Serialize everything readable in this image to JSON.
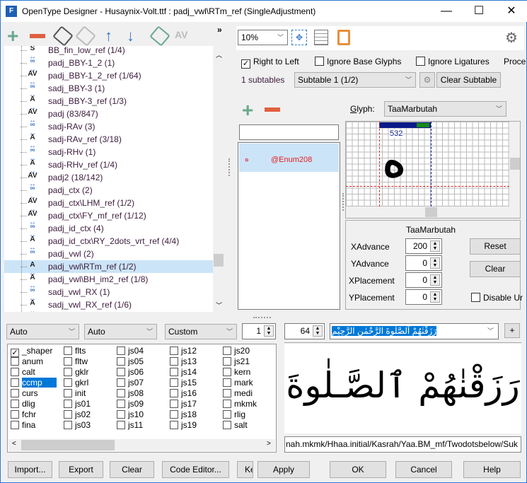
{
  "window": {
    "title": "OpenType Designer - Husaynix-Volt.ttf : padj_vwl\\RTm_ref (SingleAdjustment)",
    "app_icon": "F",
    "minimize": "—",
    "maximize": "☐",
    "close": "✕"
  },
  "left_toolbar": {
    "more": "»"
  },
  "tree": {
    "items": [
      {
        "label": "BB_fin_low_ref (1/4)",
        "icon": "S"
      },
      {
        "label": "padj_BBY-1_2 (1)",
        "icon": "link"
      },
      {
        "label": "padj_BBY-1_2_ref (1/64)",
        "icon": "AV"
      },
      {
        "label": "sadj_BBY-3 (1)",
        "icon": "link"
      },
      {
        "label": "sadj_BBY-3_ref (1/3)",
        "icon": "A"
      },
      {
        "label": "padj (83/847)",
        "icon": "AV"
      },
      {
        "label": "sadj-RAv (3)",
        "icon": "link"
      },
      {
        "label": "sadj-RAv_ref (3/18)",
        "icon": "A"
      },
      {
        "label": "sadj-RHv (1)",
        "icon": "link"
      },
      {
        "label": "sadj-RHv_ref (1/4)",
        "icon": "A"
      },
      {
        "label": "padj2 (18/142)",
        "icon": "AV"
      },
      {
        "label": "padj_ctx (2)",
        "icon": "link"
      },
      {
        "label": "padj_ctx\\LHM_ref (1/2)",
        "icon": "AV"
      },
      {
        "label": "padj_ctx\\FY_mf_ref (1/12)",
        "icon": "AV"
      },
      {
        "label": "padj_id_ctx (4)",
        "icon": "link"
      },
      {
        "label": "padj_id_ctx\\RY_2dots_vrt_ref (4/4)",
        "icon": "A"
      },
      {
        "label": "padj_vwl (2)",
        "icon": "link"
      },
      {
        "label": "padj_vwl\\RTm_ref (1/2)",
        "icon": "A",
        "selected": true
      },
      {
        "label": "padj_vwl\\BH_im2_ref (1/8)",
        "icon": "A"
      },
      {
        "label": "sadj_vwl_RX (1)",
        "icon": "link"
      },
      {
        "label": "sadj_vwl_RX_ref (1/6)",
        "icon": "A"
      }
    ]
  },
  "right_toolbar": {
    "zoom": "10%"
  },
  "options": {
    "right_to_left": "Right to Left",
    "right_to_left_checked": true,
    "ignore_base": "Ignore Base Glyphs",
    "ignore_ligatures": "Ignore Ligatures",
    "process": "Proce"
  },
  "subtables": {
    "count": "1 subtables",
    "selected": "Subtable 1 (1/2)",
    "clear": "Clear Subtable"
  },
  "glyph": {
    "label": "Glyph:",
    "value": "TaaMarbutah"
  },
  "coverage": {
    "search": "",
    "items": [
      {
        "glyph": "ه",
        "name": "@Enum208"
      }
    ]
  },
  "preview_grid": {
    "advance_label": "532",
    "glyph": "ه"
  },
  "params": {
    "title": "TaaMarbutah",
    "xadvance_label": "XAdvance",
    "xadvance": "200",
    "yadvance_label": "YAdvance",
    "yadvance": "0",
    "xplacement_label": "XPlacement",
    "xplacement": "0",
    "yplacement_label": "YPlacement",
    "yplacement": "0",
    "reset": "Reset",
    "clear": "Clear",
    "disable": "Disable Ur"
  },
  "shaping": {
    "script": "Auto",
    "language": "Auto",
    "mode": "Custom",
    "count": "1"
  },
  "features": [
    {
      "name": "_shaper",
      "checked": true
    },
    {
      "name": "anum"
    },
    {
      "name": "calt"
    },
    {
      "name": "ccmp",
      "highlight": true
    },
    {
      "name": "curs"
    },
    {
      "name": "dlig"
    },
    {
      "name": "fchr"
    },
    {
      "name": "fina"
    },
    {
      "name": "flts"
    },
    {
      "name": "fltw"
    },
    {
      "name": "gklr"
    },
    {
      "name": "gkrl"
    },
    {
      "name": "init"
    },
    {
      "name": "js01"
    },
    {
      "name": "js02"
    },
    {
      "name": "js03"
    },
    {
      "name": "js04"
    },
    {
      "name": "js05"
    },
    {
      "name": "js06"
    },
    {
      "name": "js07"
    },
    {
      "name": "js08"
    },
    {
      "name": "js09"
    },
    {
      "name": "js10"
    },
    {
      "name": "js11"
    },
    {
      "name": "js12"
    },
    {
      "name": "js13"
    },
    {
      "name": "js14"
    },
    {
      "name": "js15"
    },
    {
      "name": "js16"
    },
    {
      "name": "js17"
    },
    {
      "name": "js18"
    },
    {
      "name": "js19"
    },
    {
      "name": "js20"
    },
    {
      "name": "js21"
    },
    {
      "name": "kern"
    },
    {
      "name": "mark"
    },
    {
      "name": "medi"
    },
    {
      "name": "mkmk"
    },
    {
      "name": "rlig"
    },
    {
      "name": "salt"
    }
  ],
  "text_preview": {
    "size": "64",
    "text": "رَزَقْنٰهُمْ اَلصَّلٰوةَ الرَّحْمٰنِ الرَّحِيْمِ",
    "add": "+",
    "rendered": "رَزَقْنٰهُمْ ٱلصَّـلٰوةَ",
    "glyph_path": "nah.mkmk/Hhaa.initial/Kasrah/Yaa.BM_mf/Twodotsbelow/Suk"
  },
  "buttons": {
    "import": "Import...",
    "export": "Export",
    "clear": "Clear",
    "code_editor": "Code Editor...",
    "ke": "Ke",
    "apply": "Apply",
    "ok": "OK",
    "cancel": "Cancel",
    "help": "Help"
  },
  "colors": {
    "add": "#6aa88c",
    "remove": "#e06040",
    "arrow": "#3a78c4",
    "selection": "#cce4f7",
    "highlight": "#0078d7",
    "red": "#e02020"
  }
}
